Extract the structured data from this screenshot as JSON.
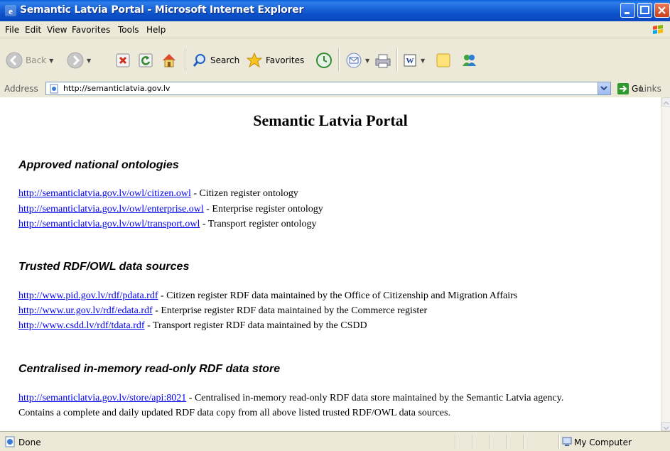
{
  "window": {
    "title": "Semantic Latvia Portal - Microsoft Internet Explorer"
  },
  "menu": [
    "File",
    "Edit",
    "View",
    "Favorites",
    "Tools",
    "Help"
  ],
  "toolbar": {
    "back": "Back",
    "search": "Search",
    "favorites": "Favorites",
    "go": "Go",
    "links": "Links"
  },
  "address": {
    "label": "Address",
    "url": "http://semanticlatvia.gov.lv"
  },
  "page": {
    "title": "Semantic Latvia Portal",
    "sections": [
      {
        "heading": "Approved national ontologies",
        "items": [
          {
            "link": "http://semanticlatvia.gov.lv/owl/citizen.owl",
            "text": " - Citizen register ontology"
          },
          {
            "link": "http://semanticlatvia.gov.lv/owl/enterprise.owl",
            "text": " - Enterprise register ontology"
          },
          {
            "link": "http://semanticlatvia.gov.lv/owl/transport.owl",
            "text": " - Transport register ontology"
          }
        ]
      },
      {
        "heading": "Trusted RDF/OWL data sources",
        "items": [
          {
            "link": "http://www.pid.gov.lv/rdf/pdata.rdf",
            "text": " - Citizen register RDF data maintained by the Office of Citizenship and Migration Affairs"
          },
          {
            "link": "http://www.ur.gov.lv/rdf/edata.rdf",
            "text": " - Enterprise register RDF data maintained by the Commerce register"
          },
          {
            "link": "http://www.csdd.lv/rdf/tdata.rdf",
            "text": " - Transport register RDF data maintained by the CSDD"
          }
        ]
      },
      {
        "heading": "Centralised in-memory read-only RDF data store",
        "items": [
          {
            "link": "http://semanticlatvia.gov.lv/store/api:8021",
            "text": " - Centralised in-memory read-only RDF data store maintained by the Semantic Latvia agency."
          }
        ],
        "continuation": "Contains a complete and daily updated RDF data copy from all above listed trusted RDF/OWL data sources."
      }
    ]
  },
  "status": {
    "text": "Done",
    "zone": "My Computer"
  }
}
